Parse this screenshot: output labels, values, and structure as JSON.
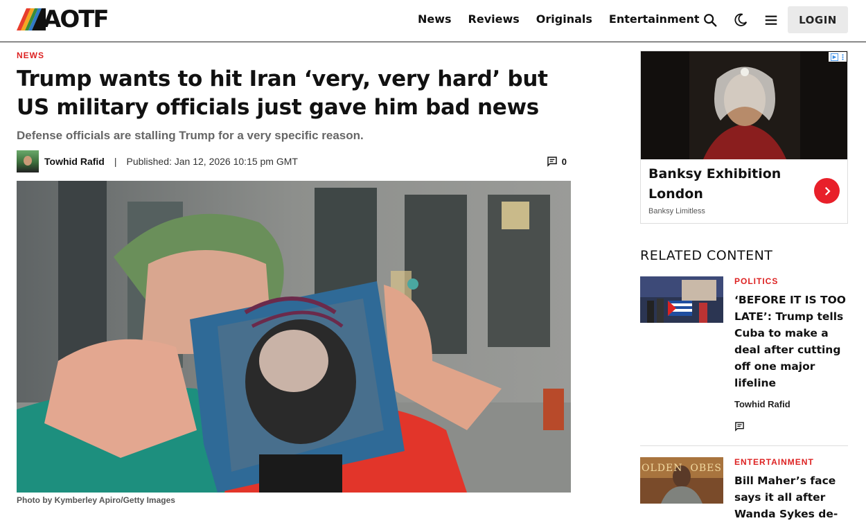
{
  "brand": {
    "logo_text": "AOTF"
  },
  "nav": {
    "items": [
      "News",
      "Reviews",
      "Originals",
      "Entertainment"
    ],
    "login_label": "LOGIN"
  },
  "icons": {
    "search": "search-icon",
    "theme": "moon-icon",
    "menu": "hamburger-menu-icon",
    "comment": "comment-icon"
  },
  "article": {
    "category": "NEWS",
    "headline": "Trump wants to hit Iran ‘very, very hard’ but US military officials just gave him bad news",
    "subheadline": "Defense officials are stalling Trump for a very specific reason.",
    "author": "Towhid Rafid",
    "separator": "|",
    "published": "Published: Jan 12, 2026 10:15 pm GMT",
    "comment_count": "0",
    "photo_credit": "Photo by Kymberley Apiro/Getty Images"
  },
  "ad": {
    "title": "Banksy Exhibition London",
    "source": "Banksy Limitless"
  },
  "related": {
    "heading": "RELATED CONTENT",
    "items": [
      {
        "category": "POLITICS",
        "title": "‘BEFORE IT IS TOO LATE’: Trump tells Cuba to make a deal after cutting off one major lifeline",
        "author": "Towhid Rafid"
      },
      {
        "category": "ENTERTAINMENT",
        "title": "Bill Maher’s face says it all after Wanda Sykes de-",
        "thumb_text": "OLDEN  OBES"
      }
    ]
  },
  "colors": {
    "accent": "#dd2222",
    "ad_button": "#e8202a",
    "text": "#111111",
    "muted": "#666666"
  }
}
